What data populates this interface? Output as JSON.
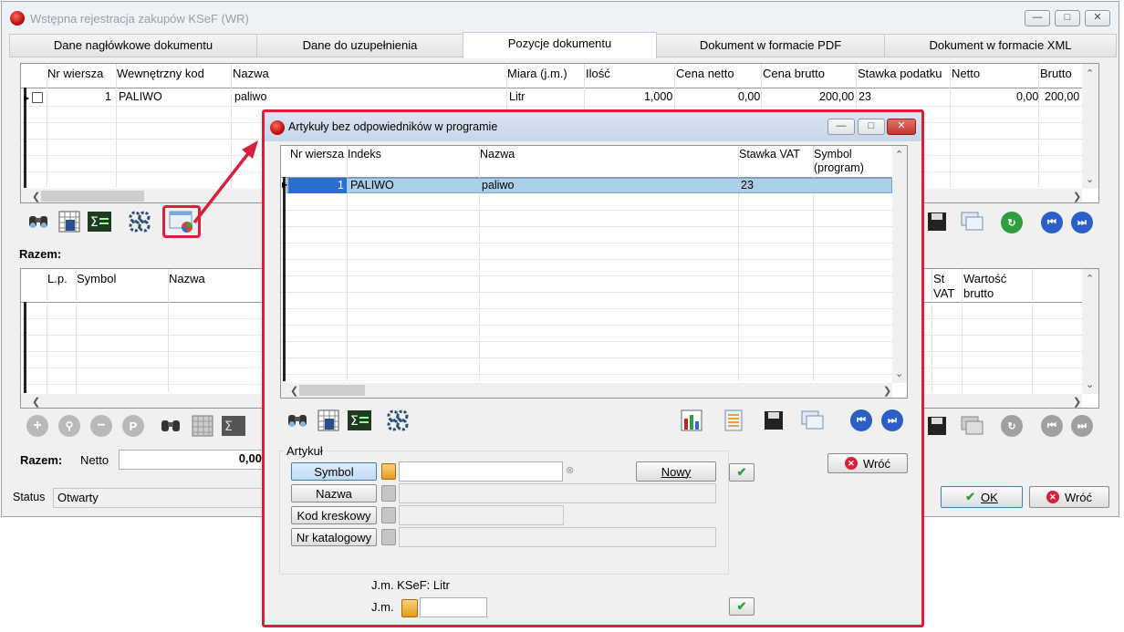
{
  "main": {
    "title": "Wstępna rejestracja zakupów KSeF (WR)",
    "tabs": [
      "Dane nagłówkowe dokumentu",
      "Dane do uzupełnienia",
      "Pozycje dokumentu",
      "Dokument w formacie PDF",
      "Dokument w formacie XML"
    ],
    "positions_table": {
      "columns": [
        "Nr wiersza",
        "Wewnętrzny kod",
        "Nazwa",
        "Miara (j.m.)",
        "Ilość",
        "Cena netto",
        "Cena brutto",
        "Stawka podatku",
        "Netto",
        "Brutto"
      ],
      "row": {
        "nr": "1",
        "kod": "PALIWO",
        "nazwa": "paliwo",
        "miara": "Litr",
        "ilosc": "1,000",
        "cena_netto": "0,00",
        "cena_brutto": "200,00",
        "stawka": "23",
        "netto": "0,00",
        "brutto": "200,00"
      }
    },
    "razem_label": "Razem:",
    "summary_table": {
      "columns": [
        "L.p.",
        "Symbol",
        "Nazwa",
        "St VAT",
        "Wartość brutto"
      ],
      "st_vat_line2": "VAT",
      "st_vat_line1": "St"
    },
    "bottom_razem": {
      "label": "Razem:",
      "netto_label": "Netto",
      "netto_value": "0,00"
    },
    "status": {
      "label": "Status",
      "value": "Otwarty"
    },
    "ok_button": "OK",
    "cancel_button": "Wróć"
  },
  "dialog": {
    "title": "Artykuły bez odpowiedników w programie",
    "columns": [
      "Nr wiersza",
      "Indeks",
      "Nazwa",
      "Stawka VAT",
      "Symbol (program)"
    ],
    "row": {
      "nr": "1",
      "indeks": "PALIWO",
      "nazwa": "paliwo",
      "stawka": "23",
      "symbol": ""
    },
    "artykul_group": "Artykuł",
    "fields": {
      "symbol": "Symbol",
      "nazwa": "Nazwa",
      "kod": "Kod kreskowy",
      "nr_kat": "Nr katalogowy"
    },
    "nowy_button": "Nowy",
    "wroc_button": "Wróć",
    "jm_ksef": "J.m. KSeF: Litr",
    "jm_label": "J.m."
  },
  "colors": {
    "accent_red": "#d8203a",
    "selection": "#aacfe9",
    "nav_blue": "#2b5fc7"
  }
}
